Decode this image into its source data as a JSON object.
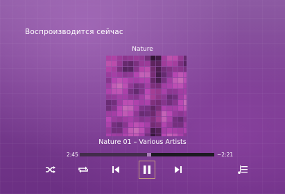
{
  "header": {
    "title": "Воспроизводится сейчас"
  },
  "album": {
    "title": "Nature"
  },
  "track": {
    "info": "Nature 01 – Various Artists"
  },
  "playback": {
    "elapsed": "2:45",
    "remaining": "−2:21",
    "progress": 0.5
  },
  "controls": {
    "shuffle_icon": "shuffle-icon",
    "repeat_icon": "repeat-icon",
    "previous_icon": "skip-previous-icon",
    "pause_icon": "pause-icon",
    "next_icon": "skip-next-icon",
    "queue_icon": "playlist-icon"
  },
  "colors": {
    "accent": "#e6c878",
    "background": "#7a3f91"
  }
}
